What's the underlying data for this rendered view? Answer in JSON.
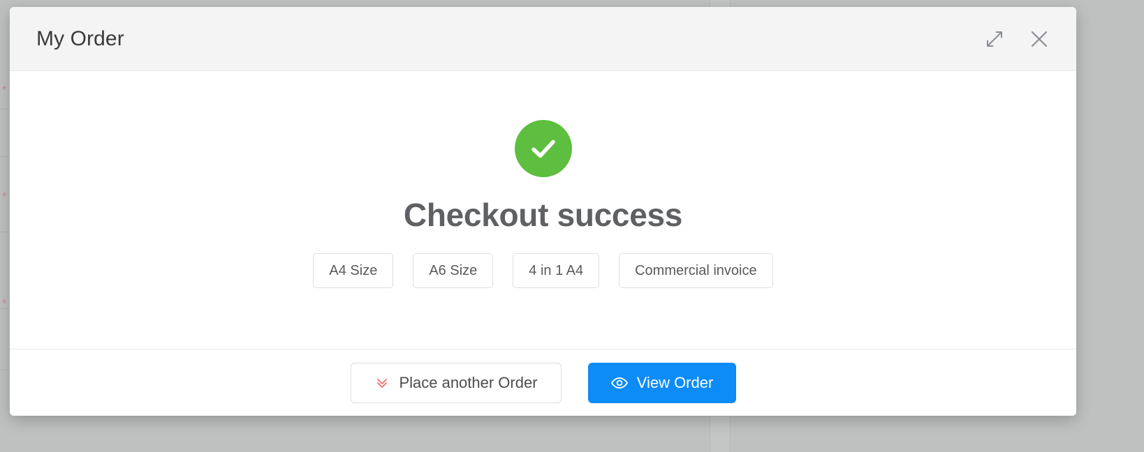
{
  "background": {
    "required_marker": "*",
    "required_marker_color": "#c98a8a",
    "overlay_color": "#bfc0c0"
  },
  "modal": {
    "header": {
      "title": "My Order",
      "actions": [
        {
          "name": "expand-icon",
          "label": "Expand"
        },
        {
          "name": "close-icon",
          "label": "Close"
        }
      ]
    },
    "body": {
      "status_icon": "check-circle-icon",
      "status_color": "#5ebe3f",
      "title": "Checkout success",
      "title_color": "#5f6063",
      "print_options": [
        {
          "label": "A4 Size"
        },
        {
          "label": "A6 Size"
        },
        {
          "label": "4 in 1 A4"
        },
        {
          "label": "Commercial invoice"
        }
      ]
    },
    "footer": {
      "secondary_button": {
        "label": "Place another Order",
        "icon": "double-chevron-down-icon",
        "icon_color": "#f56c6c"
      },
      "primary_button": {
        "label": "View Order",
        "icon": "eye-icon",
        "background": "#0d8bf7",
        "text_color": "#ffffff"
      }
    }
  }
}
